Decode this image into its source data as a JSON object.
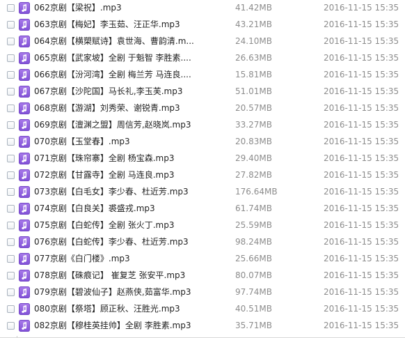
{
  "colors": {
    "name_text": "#222222",
    "meta_text": "#8c8c8c",
    "music_icon": "#8b5cf6"
  },
  "icons": {
    "file_type_icon": "music-note-icon",
    "select_icon": "checkbox-icon"
  },
  "files": [
    {
      "name": "062京剧【梁祝】.mp3",
      "size": "41.42MB",
      "date": "2016-11-15 15:35"
    },
    {
      "name": "063京剧【梅妃】李玉茹、汪正华.mp3",
      "size": "43.21MB",
      "date": "2016-11-15 15:35"
    },
    {
      "name": "064京剧【横槊赋诗】袁世海、曹韵清.m...",
      "size": "24.10MB",
      "date": "2016-11-15 15:35"
    },
    {
      "name": "065京剧【武家坡】全剧 于魁智 李胜素....",
      "size": "26.63MB",
      "date": "2016-11-15 15:35"
    },
    {
      "name": "066京剧【汾河湾】全剧 梅兰芳 马连良....",
      "size": "15.81MB",
      "date": "2016-11-15 15:35"
    },
    {
      "name": "067京剧【沙陀国】马长礼,李玉芙.mp3",
      "size": "51.01MB",
      "date": "2016-11-15 15:35"
    },
    {
      "name": "068京剧【游湖】刘秀荣、谢锐青.mp3",
      "size": "20.57MB",
      "date": "2016-11-15 15:35"
    },
    {
      "name": "069京剧【澶渊之盟】周信芳,赵晓岚.mp3",
      "size": "33.27MB",
      "date": "2016-11-15 15:35"
    },
    {
      "name": "070京剧【玉堂春】.mp3",
      "size": "20.83MB",
      "date": "2016-11-15 15:35"
    },
    {
      "name": "071京剧【珠帘寨】全剧 杨宝森.mp3",
      "size": "29.40MB",
      "date": "2016-11-15 15:35"
    },
    {
      "name": "072京剧【甘露寺】全剧 马连良.mp3",
      "size": "27.82MB",
      "date": "2016-11-15 15:35"
    },
    {
      "name": "073京剧【白毛女】李少春、杜近芳.mp3",
      "size": "176.64MB",
      "date": "2016-11-15 15:35"
    },
    {
      "name": "074京剧【白良关】裘盛戎.mp3",
      "size": "61.74MB",
      "date": "2016-11-15 15:35"
    },
    {
      "name": "075京剧【白蛇传】全剧 张火丁.mp3",
      "size": "25.59MB",
      "date": "2016-11-15 15:35"
    },
    {
      "name": "076京剧【白蛇传】李少春、杜近芳.mp3",
      "size": "98.24MB",
      "date": "2016-11-15 15:35"
    },
    {
      "name": "077京剧《白门楼》.mp3",
      "size": "25.66MB",
      "date": "2016-11-15 15:35"
    },
    {
      "name": "078京剧【硃痕记】 崔复芝 张安平.mp3",
      "size": "80.07MB",
      "date": "2016-11-15 15:35"
    },
    {
      "name": "079京剧【碧波仙子】赵燕侠,茹富华.mp3",
      "size": "97.74MB",
      "date": "2016-11-15 15:35"
    },
    {
      "name": "080京剧【祭塔】顾正秋、汪胜光.mp3",
      "size": "40.51MB",
      "date": "2016-11-15 15:35"
    },
    {
      "name": "082京剧【穆桂英挂帅】全剧 李胜素.mp3",
      "size": "35.71MB",
      "date": "2016-11-15 15:35"
    }
  ]
}
